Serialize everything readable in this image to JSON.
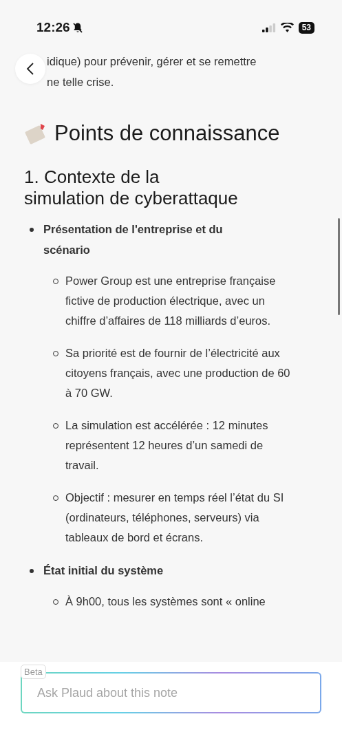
{
  "status_bar": {
    "time": "12:26",
    "battery": "53"
  },
  "intro_lines": [
    "idique) pour prévenir, gérer et se remettre",
    "ne telle crise."
  ],
  "section_title": "Points de connaissance",
  "subsection_title": "1. Contexte de la simulation de cyberattaque",
  "topics": [
    {
      "title": "Présentation de l'entreprise et du scénario",
      "points": [
        "Power Group est une entreprise française fictive de production électrique, avec un chiffre d’affaires de 118 milliards d’euros.",
        "Sa priorité est de fournir de l’électricité aux citoyens français, avec une production de 60 à 70 GW.",
        "La simulation est accélérée : 12 minutes représentent 12 heures d’un samedi de travail.",
        "Objectif : mesurer en temps réel l’état du SI (ordinateurs, téléphones, serveurs) via tableaux de bord et écrans."
      ]
    },
    {
      "title": "État initial du système",
      "points": [
        "À 9h00, tous les systèmes sont « online"
      ]
    }
  ],
  "ask_field": {
    "tag": "Beta",
    "placeholder": "Ask Plaud about this note"
  }
}
